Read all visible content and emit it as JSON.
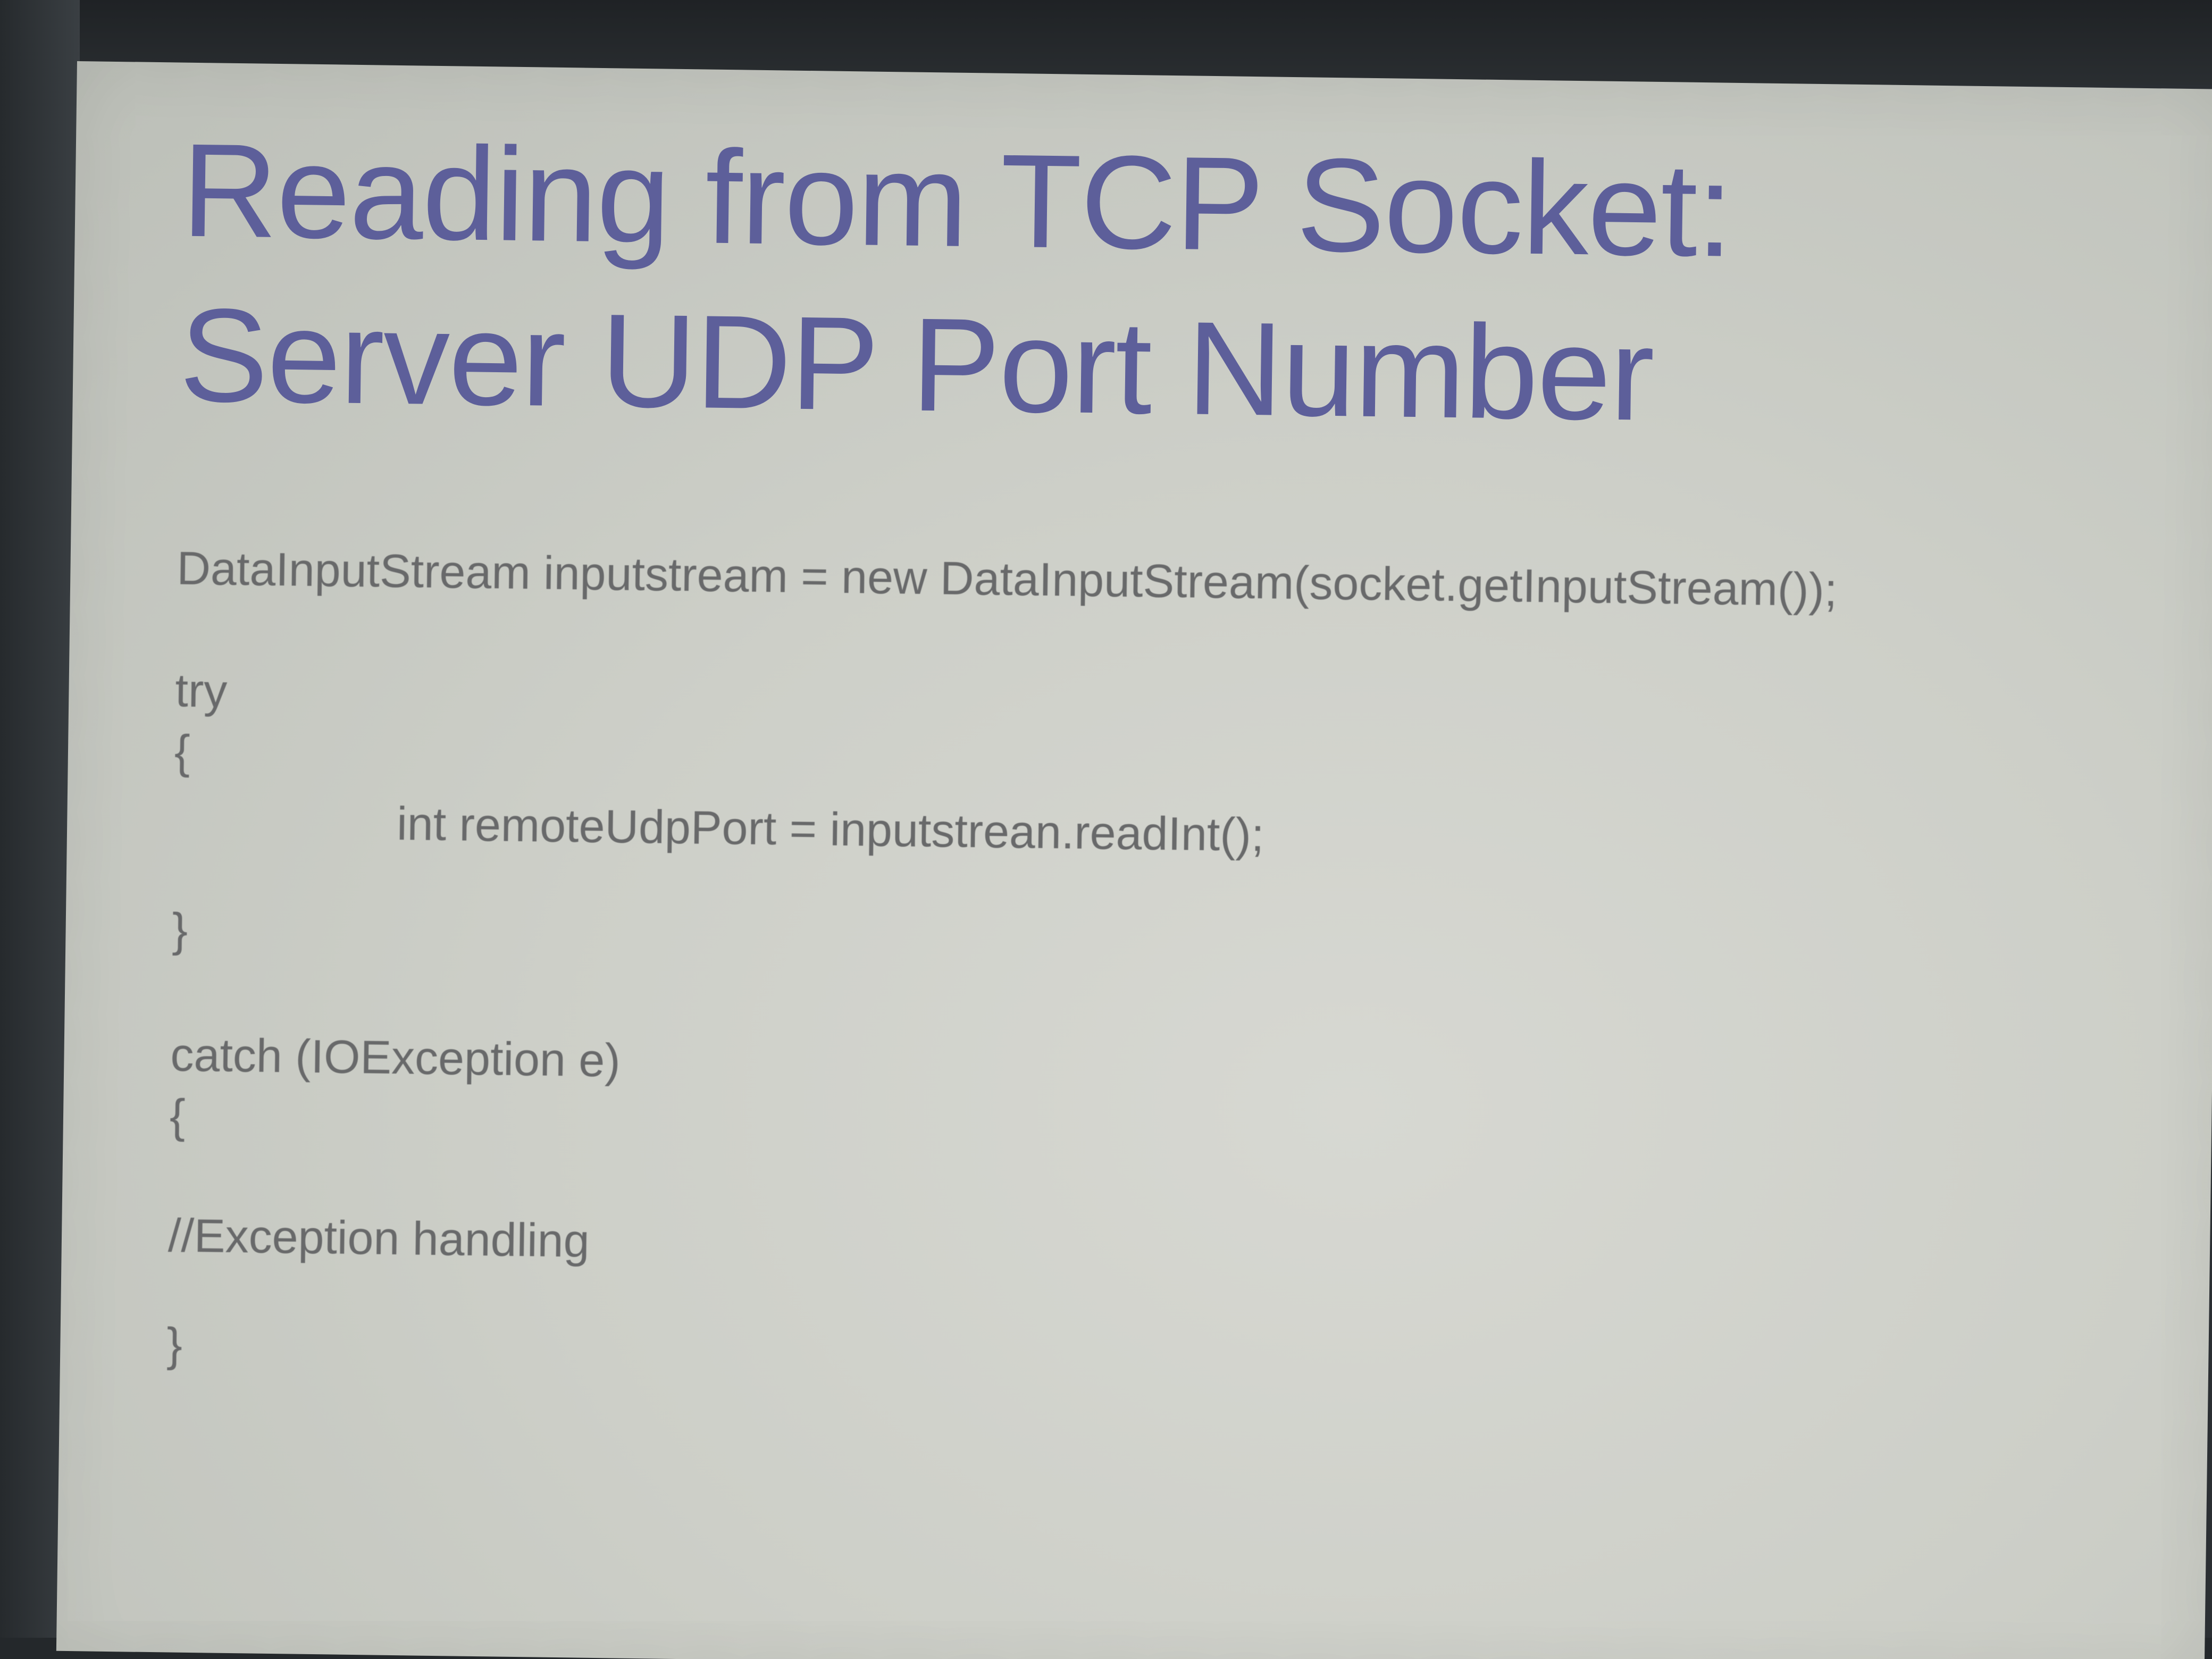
{
  "slide": {
    "title_line1": "Reading from TCP Socket:",
    "title_line2": "Server UDP Port Number",
    "code": {
      "line1": "DataInputStream inputstream = new DataInputStream(socket.getInputStream());",
      "line2": "try",
      "line3": "{",
      "line4": "int remoteUdpPort = inputstrean.readInt();",
      "line5": "}",
      "line6": "catch (IOException e)",
      "line7": "{",
      "line8": "//Exception handling",
      "line9": "}"
    }
  }
}
